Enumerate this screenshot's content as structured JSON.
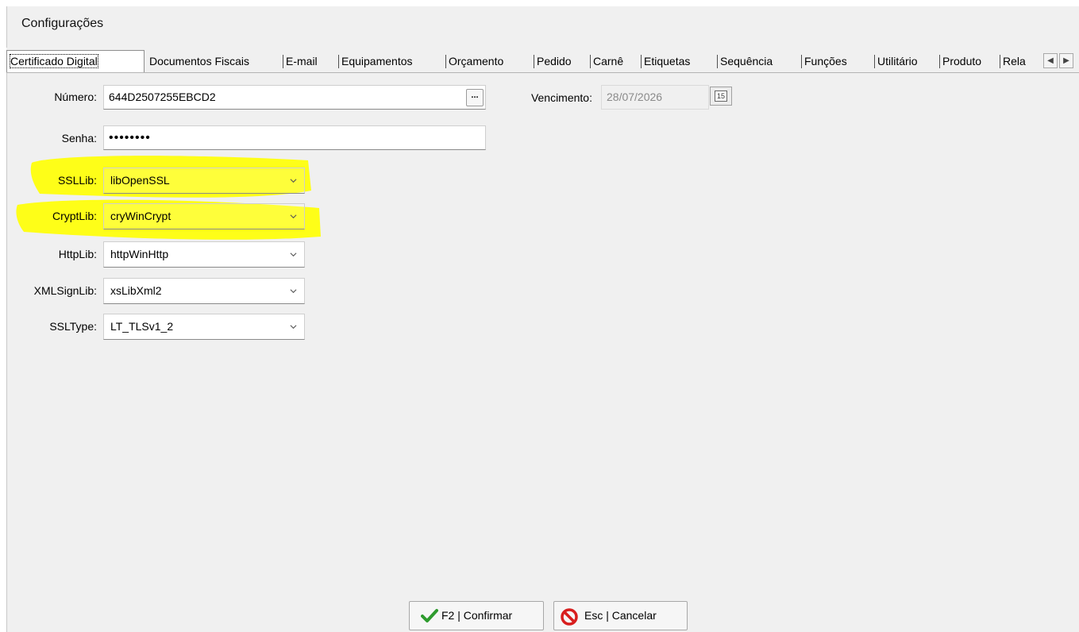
{
  "window": {
    "title": "Configurações"
  },
  "tabs": [
    {
      "label": "Certificado Digital"
    },
    {
      "label": "Documentos Fiscais"
    },
    {
      "label": "E-mail"
    },
    {
      "label": "Equipamentos"
    },
    {
      "label": "Orçamento"
    },
    {
      "label": "Pedido"
    },
    {
      "label": "Carnê"
    },
    {
      "label": "Etiquetas"
    },
    {
      "label": "Sequência"
    },
    {
      "label": "Funções"
    },
    {
      "label": "Utilitário"
    },
    {
      "label": "Produto"
    },
    {
      "label": "Rela"
    }
  ],
  "tab_scroll": {
    "left_glyph": "◀",
    "right_glyph": "▶"
  },
  "form": {
    "numero": {
      "label": "Número:",
      "value": "644D2507255EBCD2",
      "button_label": "..."
    },
    "vencimento": {
      "label": "Vencimento:",
      "value": "28/07/2026",
      "calendar_label": "15"
    },
    "senha": {
      "label": "Senha:",
      "value": "••••••••"
    },
    "ssllib": {
      "label": "SSLLib:",
      "value": "libOpenSSL"
    },
    "cryptlib": {
      "label": "CryptLib:",
      "value": "cryWinCrypt"
    },
    "httplib": {
      "label": "HttpLib:",
      "value": "httpWinHttp"
    },
    "xmlsignlib": {
      "label": "XMLSignLib:",
      "value": "xsLibXml2"
    },
    "ssltype": {
      "label": "SSLType:",
      "value": "LT_TLSv1_2"
    }
  },
  "footer": {
    "confirm_label": "F2 | Confirmar",
    "cancel_label": "Esc | Cancelar"
  },
  "colors": {
    "highlight": "#ffff00",
    "confirm_icon": "#2e9b2e",
    "cancel_icon": "#d81e1e"
  },
  "icons": {
    "confirm": "checkmark-icon",
    "cancel": "no-entry-icon",
    "calendar": "calendar-icon",
    "dropdown": "chevron-down-icon"
  }
}
